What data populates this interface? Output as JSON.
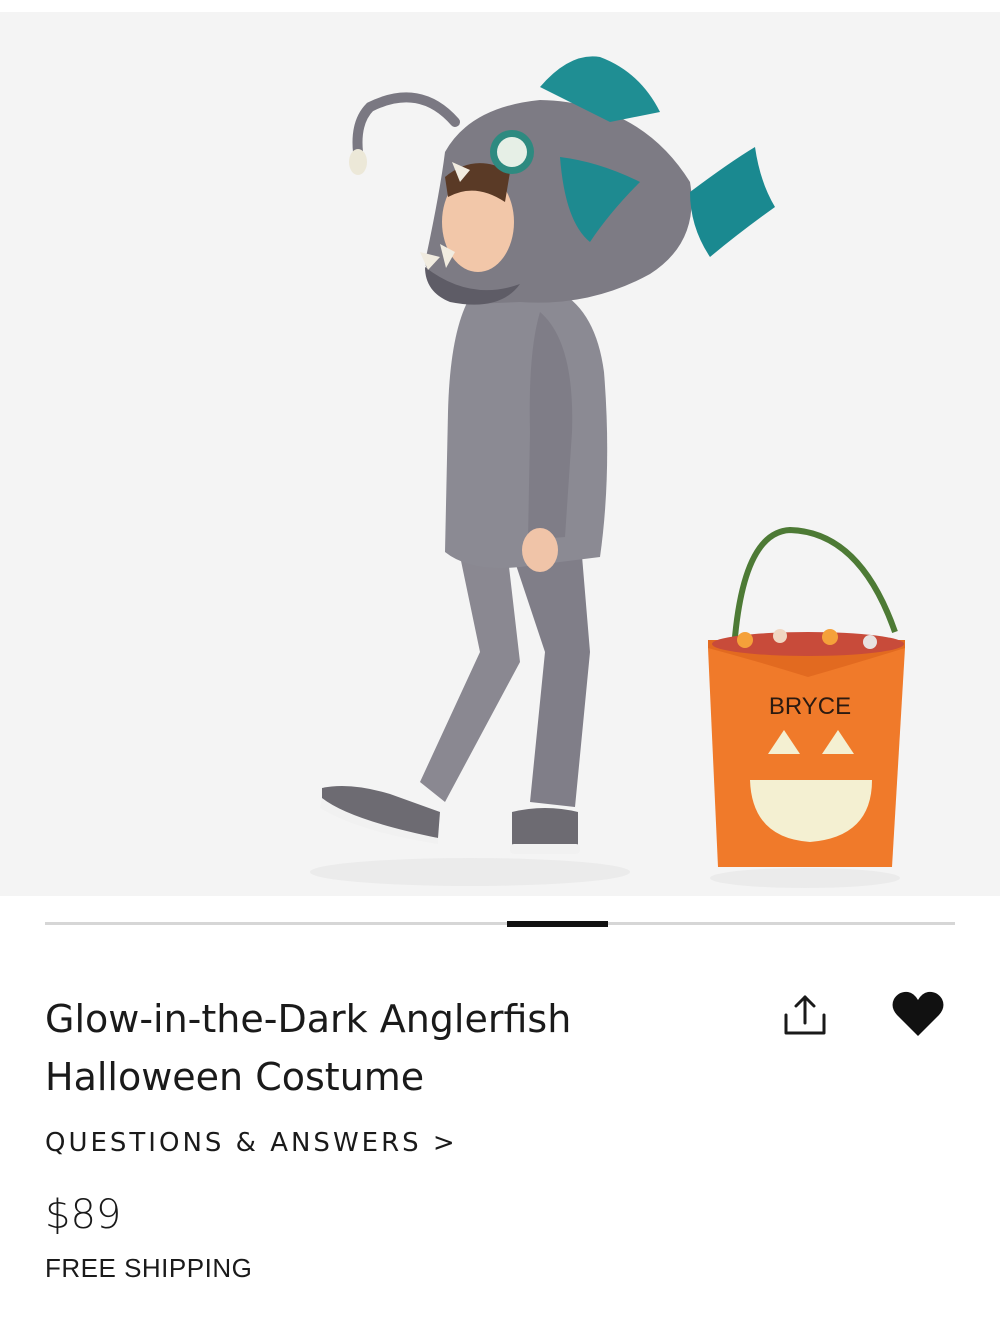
{
  "product": {
    "title_line1": "Glow-in-the-Dark Anglerfish",
    "title_line2": "Halloween Costume",
    "qa_link": "QUESTIONS & ANSWERS >",
    "price": "$89",
    "shipping": "FREE SHIPPING"
  },
  "image": {
    "bucket_name": "BRYCE",
    "gallery_position": 0.55
  },
  "icons": {
    "share": "share-icon",
    "favorite": "heart-icon"
  },
  "colors": {
    "pager_active": "#111111",
    "pager_track": "#d6d6d6",
    "heart": "#111111",
    "bucket_orange": "#f07a2a"
  }
}
